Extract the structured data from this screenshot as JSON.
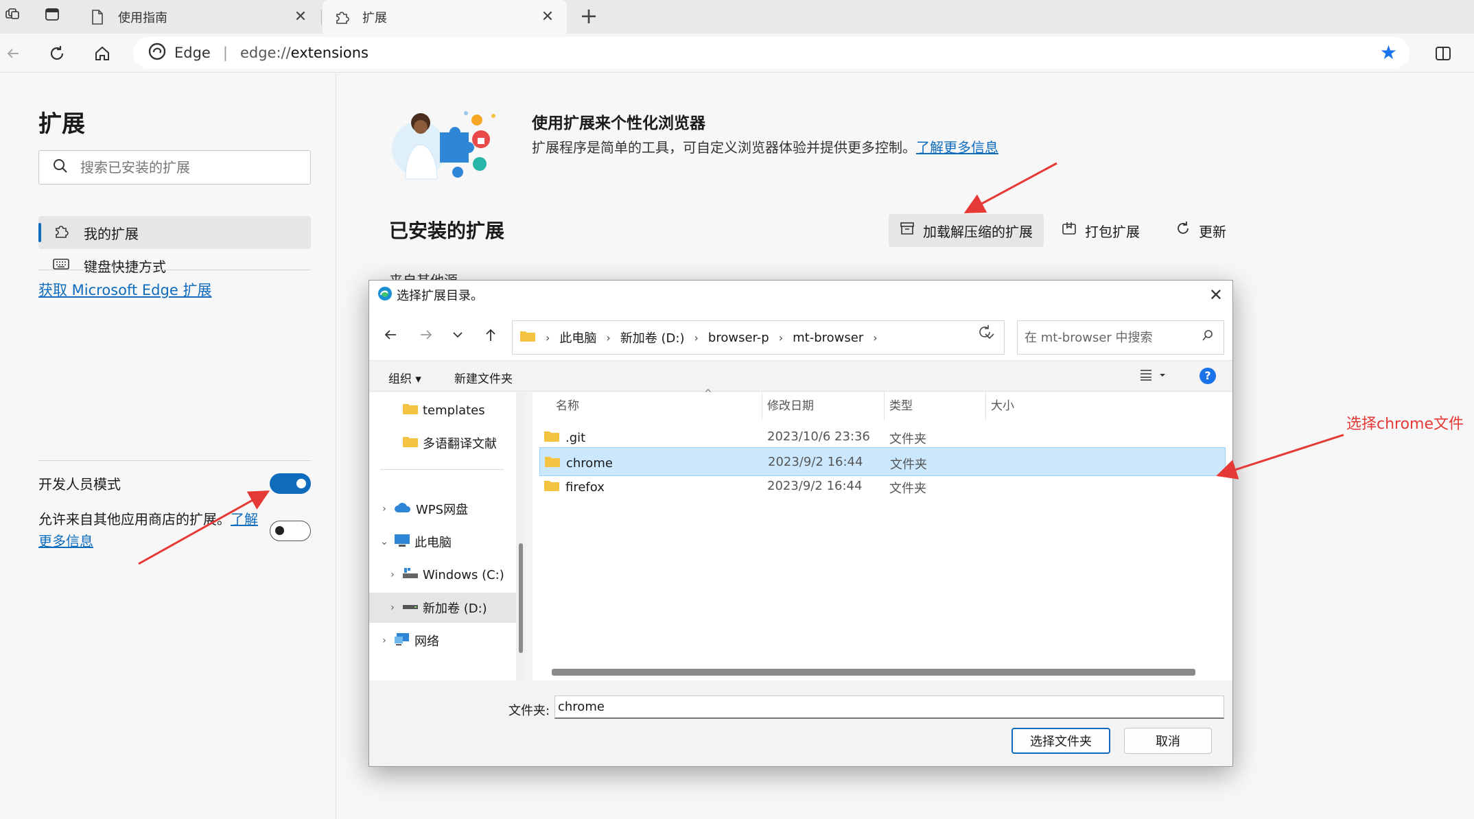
{
  "browser": {
    "tabs": [
      {
        "label": "使用指南",
        "active": false
      },
      {
        "label": "扩展",
        "active": true
      }
    ],
    "address": {
      "brand": "Edge",
      "scheme": "edge://",
      "path": "extensions"
    }
  },
  "sidebar": {
    "title": "扩展",
    "search_placeholder": "搜索已安装的扩展",
    "items": [
      {
        "label": "我的扩展",
        "selected": true
      },
      {
        "label": "键盘快捷方式",
        "selected": false
      }
    ],
    "get_link": "获取 Microsoft Edge 扩展",
    "developer_mode_label": "开发人员模式",
    "developer_mode_on": true,
    "allow_other_stores_label": "允许来自其他应用商店的扩展。",
    "allow_other_stores_link": "了解更多信息",
    "allow_other_stores_on": false
  },
  "main": {
    "hero_title": "使用扩展来个性化浏览器",
    "hero_desc": "扩展程序是简单的工具，可自定义浏览器体验并提供更多控制。",
    "hero_link": "了解更多信息",
    "installed_title": "已安装的扩展",
    "actions": {
      "load_unpacked": "加载解压缩的扩展",
      "pack": "打包扩展",
      "update": "更新"
    },
    "other_sources": "来自其他源"
  },
  "dialog": {
    "title": "选择扩展目录。",
    "breadcrumb": [
      "此电脑",
      "新加卷 (D:)",
      "browser-p",
      "mt-browser"
    ],
    "search_placeholder": "在 mt-browser 中搜索",
    "commands": {
      "organize": "组织 ▾",
      "new_folder": "新建文件夹"
    },
    "help": "?",
    "tree": [
      {
        "label": "templates",
        "indent": 1
      },
      {
        "label": "多语翻译文献",
        "indent": 1
      },
      {
        "label": "WPS网盘",
        "indent": 0
      },
      {
        "label": "此电脑",
        "indent": 0
      },
      {
        "label": "Windows (C:)",
        "indent": 1
      },
      {
        "label": "新加卷 (D:)",
        "indent": 1,
        "selected": true
      },
      {
        "label": "网络",
        "indent": 0
      }
    ],
    "columns": {
      "name": "名称",
      "modified": "修改日期",
      "type": "类型",
      "size": "大小"
    },
    "files": [
      {
        "name": ".git",
        "modified": "2023/10/6 23:36",
        "type": "文件夹",
        "selected": false
      },
      {
        "name": "chrome",
        "modified": "2023/9/2 16:44",
        "type": "文件夹",
        "selected": true
      },
      {
        "name": "firefox",
        "modified": "2023/9/2 16:44",
        "type": "文件夹",
        "selected": false
      }
    ],
    "folder_label": "文件夹:",
    "folder_value": "chrome",
    "select_button": "选择文件夹",
    "cancel_button": "取消"
  },
  "annotation": {
    "text": "选择chrome文件",
    "color": "#e53935"
  },
  "colors": {
    "accent": "#0f6cbd",
    "selection": "#cce8ff",
    "folder": "#f5c342"
  }
}
